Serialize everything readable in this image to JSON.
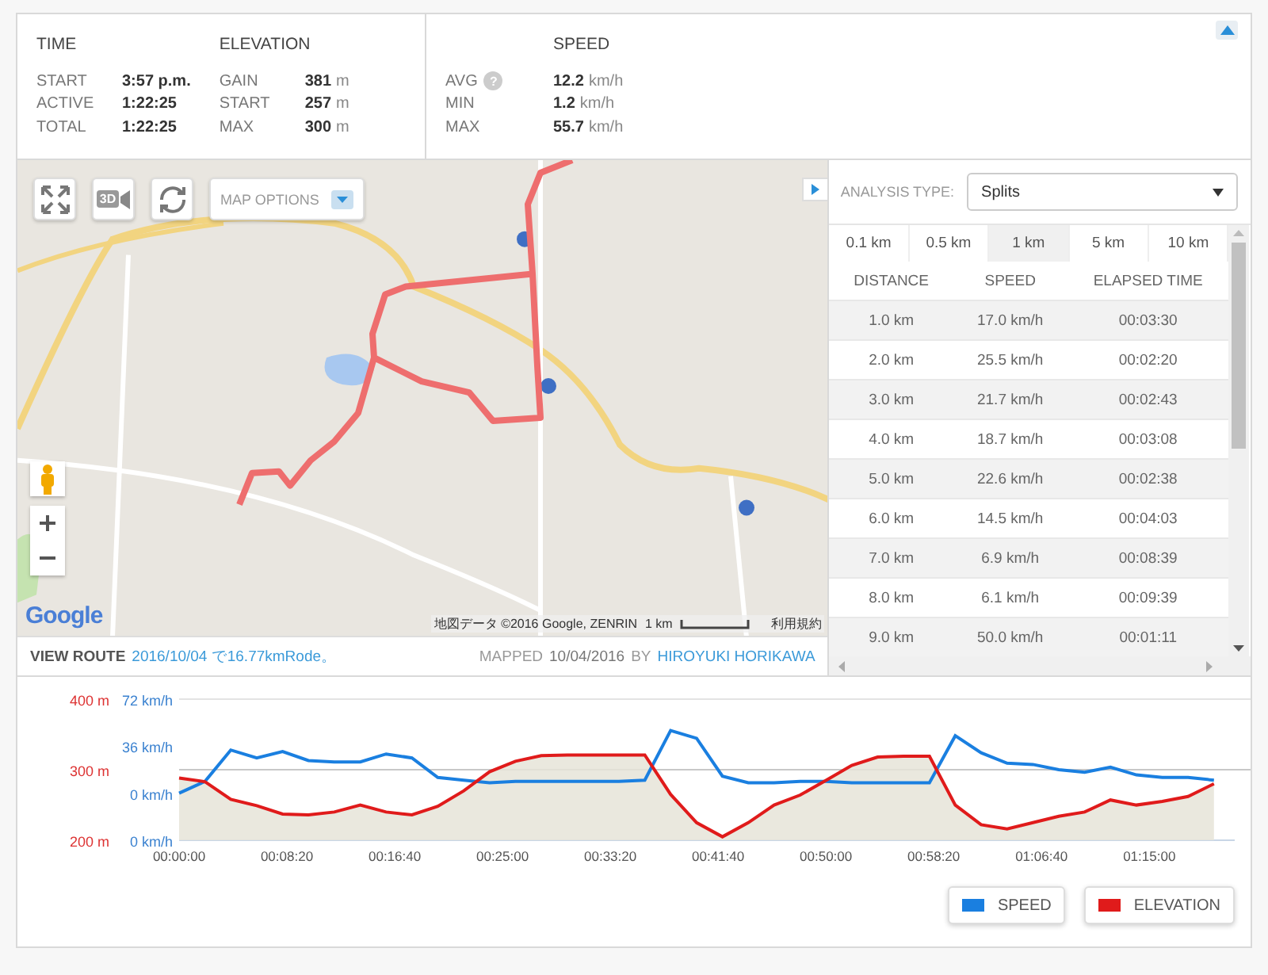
{
  "stat_groups": [
    {
      "sections": [
        {
          "title": "TIME",
          "rows": [
            {
              "label": "START",
              "value": "3:57 p.m."
            },
            {
              "label": "ACTIVE",
              "value": "1:22:25"
            },
            {
              "label": "TOTAL",
              "value": "1:22:25"
            }
          ]
        },
        {
          "title": "ELEVATION",
          "rows": [
            {
              "label": "GAIN",
              "value": "381",
              "unit": "m"
            },
            {
              "label": "START",
              "value": "257",
              "unit": "m"
            },
            {
              "label": "MAX",
              "value": "300",
              "unit": "m"
            }
          ]
        }
      ]
    },
    {
      "sections": [
        {
          "title": "SPEED",
          "rows": [
            {
              "label": "AVG",
              "help": "?",
              "value": "12.2",
              "unit": "km/h"
            },
            {
              "label": "MIN",
              "value": "1.2",
              "unit": "km/h"
            },
            {
              "label": "MAX",
              "value": "55.7",
              "unit": "km/h"
            }
          ]
        }
      ]
    }
  ],
  "map": {
    "map_options": "MAP OPTIONS",
    "badge_3d": "3D",
    "attribution": "地図データ ©2016 Google, ZENRIN",
    "scale": "1 km",
    "terms": "利用規約",
    "logo": "Google"
  },
  "route_bar": {
    "label": "VIEW ROUTE",
    "link": "2016/10/04 で16.77kmRode。",
    "mapped_label": "MAPPED",
    "mapped_date": "10/04/2016",
    "by": "BY",
    "author": "HIROYUKI HORIKAWA"
  },
  "analysis": {
    "label": "ANALYSIS TYPE:",
    "value": "Splits",
    "intervals": [
      {
        "label": "0.1 km",
        "selected": false
      },
      {
        "label": "0.5 km",
        "selected": false
      },
      {
        "label": "1 km",
        "selected": true
      },
      {
        "label": "5 km",
        "selected": false
      },
      {
        "label": "10 km",
        "selected": false
      }
    ],
    "columns": [
      "DISTANCE",
      "SPEED",
      "ELAPSED TIME"
    ],
    "rows": [
      [
        "1.0 km",
        "17.0 km/h",
        "00:03:30"
      ],
      [
        "2.0 km",
        "25.5 km/h",
        "00:02:20"
      ],
      [
        "3.0 km",
        "21.7 km/h",
        "00:02:43"
      ],
      [
        "4.0 km",
        "18.7 km/h",
        "00:03:08"
      ],
      [
        "5.0 km",
        "22.6 km/h",
        "00:02:38"
      ],
      [
        "6.0 km",
        "14.5 km/h",
        "00:04:03"
      ],
      [
        "7.0 km",
        "6.9 km/h",
        "00:08:39"
      ],
      [
        "8.0 km",
        "6.1 km/h",
        "00:09:39"
      ],
      [
        "9.0 km",
        "50.0 km/h",
        "00:01:11"
      ]
    ]
  },
  "chart": {
    "chart_data": {
      "type": "line",
      "x": [
        0,
        2,
        4,
        6,
        8,
        10,
        12,
        14,
        16,
        18,
        20,
        22,
        24,
        26,
        28,
        30,
        32,
        34,
        36,
        38,
        40,
        42,
        44,
        46,
        48,
        50,
        52,
        54,
        56,
        58,
        60,
        62,
        64,
        66,
        68,
        70,
        72,
        74,
        76,
        78,
        80
      ],
      "xlim": [
        0,
        81.6
      ],
      "xticks": [
        {
          "value": 0,
          "label": "00:00:00"
        },
        {
          "value": 8.333,
          "label": "00:08:20"
        },
        {
          "value": 16.667,
          "label": "00:16:40"
        },
        {
          "value": 25,
          "label": "00:25:00"
        },
        {
          "value": 33.333,
          "label": "00:33:20"
        },
        {
          "value": 41.667,
          "label": "00:41:40"
        },
        {
          "value": 50,
          "label": "00:50:00"
        },
        {
          "value": 58.333,
          "label": "00:58:20"
        },
        {
          "value": 66.667,
          "label": "01:06:40"
        },
        {
          "value": 75,
          "label": "01:15:00"
        }
      ],
      "ylim": [
        200,
        400
      ],
      "yticks": [
        {
          "value": 200,
          "label": "200 m"
        },
        {
          "value": 300,
          "label": "300 m"
        },
        {
          "value": 400,
          "label": "400 m"
        }
      ],
      "y2lim": [
        -36,
        72
      ],
      "y2ticks": [
        {
          "value": 0,
          "label": "0 km/h"
        },
        {
          "value": 36,
          "label": "36 km/h"
        },
        {
          "value": 72,
          "label": "72 km/h"
        }
      ],
      "series": [
        {
          "name": "SPEED",
          "color": "#1a7fe0",
          "axis": "y2",
          "values": [
            0,
            9,
            33,
            27,
            32,
            25,
            24,
            24,
            30,
            27,
            12,
            10,
            8,
            9,
            9,
            9,
            9,
            9,
            10,
            48,
            42,
            13,
            8,
            8,
            9,
            9,
            8,
            8,
            8,
            8,
            44,
            31,
            23,
            22,
            18,
            16,
            20,
            14,
            12,
            12,
            10
          ]
        },
        {
          "name": "ELEVATION",
          "color": "#e01b1b",
          "axis": "y",
          "values": [
            288,
            283,
            258,
            249,
            237,
            236,
            240,
            250,
            240,
            236,
            248,
            270,
            297,
            312,
            320,
            321,
            321,
            321,
            321,
            265,
            225,
            205,
            225,
            250,
            264,
            285,
            306,
            318,
            319,
            319,
            250,
            222,
            216,
            225,
            234,
            240,
            257,
            250,
            255,
            262,
            280
          ]
        }
      ]
    },
    "speed_axis_floor_label": "0 km/h"
  }
}
